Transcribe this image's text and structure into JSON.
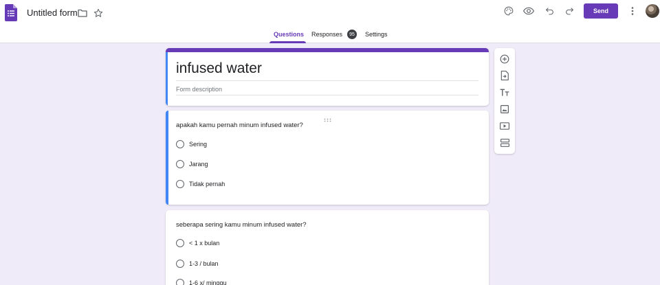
{
  "header": {
    "doc_title": "Untitled form",
    "send_label": "Send"
  },
  "tabs": [
    {
      "label": "Questions",
      "active": true
    },
    {
      "label": "Responses",
      "badge": "95"
    },
    {
      "label": "Settings"
    }
  ],
  "form": {
    "title": "infused water",
    "description_placeholder": "Form description"
  },
  "questions": [
    {
      "text": "apakah kamu pernah minum infused water?",
      "options": [
        "Sering",
        "Jarang",
        "Tidak pernah"
      ]
    },
    {
      "text": "seberapa sering kamu minum infused water?",
      "options": [
        "< 1 x bulan",
        "1-3 / bulan",
        "1-6 x/ minggu"
      ]
    }
  ],
  "icons": {
    "app": "forms-icon",
    "folder": "folder-icon",
    "star": "star-icon",
    "palette": "palette-icon",
    "preview": "eye-icon",
    "undo": "undo-icon",
    "redo": "redo-icon",
    "more": "more-vert-icon"
  },
  "side_toolbar": [
    "add-question-icon",
    "import-questions-icon",
    "add-title-icon",
    "add-image-icon",
    "add-video-icon",
    "add-section-icon"
  ],
  "colors": {
    "accent": "#673ab7",
    "background": "#f0ebf8",
    "focus": "#4285f4"
  }
}
